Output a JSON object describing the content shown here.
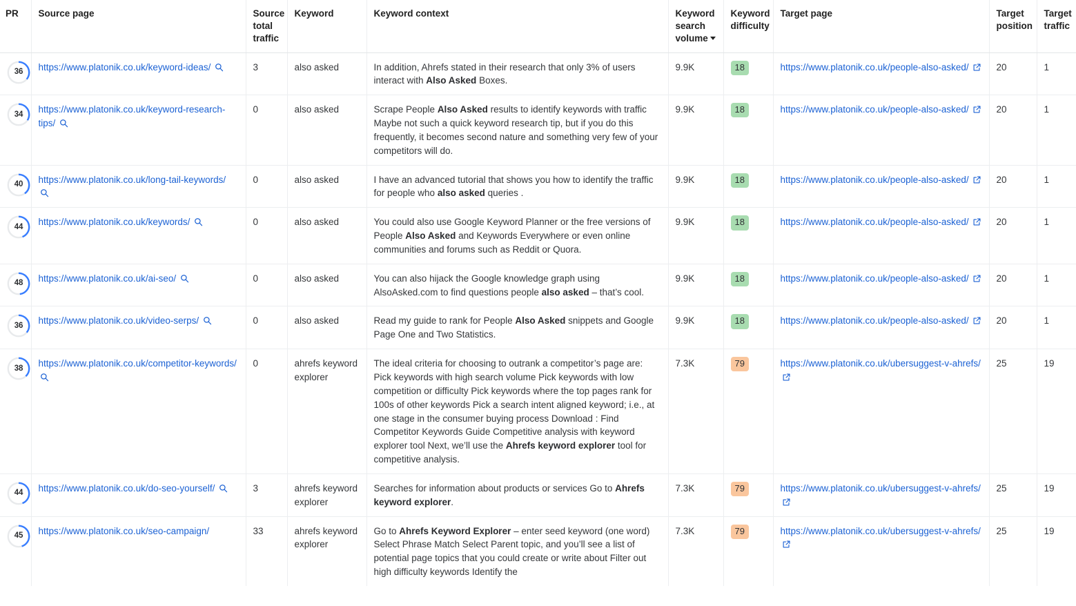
{
  "table": {
    "columns": [
      {
        "key": "pr",
        "label": "PR"
      },
      {
        "key": "source",
        "label": "Source page"
      },
      {
        "key": "stt",
        "label": "Source total traffic"
      },
      {
        "key": "keyword",
        "label": "Keyword"
      },
      {
        "key": "context",
        "label": "Keyword context"
      },
      {
        "key": "ksv",
        "label": "Keyword search volume",
        "sorted": "desc",
        "sort_icon": "caret-down-icon"
      },
      {
        "key": "kd",
        "label": "Keyword difficulty"
      },
      {
        "key": "target",
        "label": "Target page"
      },
      {
        "key": "tpos",
        "label": "Target position"
      },
      {
        "key": "ttraf",
        "label": "Target traffic"
      }
    ],
    "colors": {
      "link": "#1c62d4",
      "donut_arc": "#377dff",
      "donut_track": "#e8eaec",
      "kd_low_bg": "#a8dcb0",
      "kd_high_bg": "#fac69d",
      "border": "#eceef0"
    },
    "rows": [
      {
        "pr": "36",
        "source_url": "https://www.platonik.co.uk/keyword-ideas/",
        "source_has_search_icon": true,
        "stt": "3",
        "keyword": "also asked",
        "context_parts": [
          {
            "text": "In addition, Ahrefs stated in their research that only 3% of users interact with ",
            "bold": false
          },
          {
            "text": "Also Asked",
            "bold": true
          },
          {
            "text": " Boxes.",
            "bold": false
          }
        ],
        "ksv": "9.9K",
        "kd": "18",
        "kd_level": "low",
        "target_url": "https://www.platonik.co.uk/people-also-asked/",
        "tpos": "20",
        "ttraf": "1"
      },
      {
        "pr": "34",
        "source_url": "https://www.platonik.co.uk/keyword-research-tips/",
        "source_has_search_icon": true,
        "stt": "0",
        "keyword": "also asked",
        "context_parts": [
          {
            "text": "Scrape People ",
            "bold": false
          },
          {
            "text": "Also Asked",
            "bold": true
          },
          {
            "text": " results to identify keywords with traffic Maybe not such a quick keyword research tip, but if you do this frequently, it becomes second nature and something very few of your competitors will do.",
            "bold": false
          }
        ],
        "ksv": "9.9K",
        "kd": "18",
        "kd_level": "low",
        "target_url": "https://www.platonik.co.uk/people-also-asked/",
        "tpos": "20",
        "ttraf": "1"
      },
      {
        "pr": "40",
        "source_url": "https://www.platonik.co.uk/long-tail-keywords/",
        "source_has_search_icon": true,
        "stt": "0",
        "keyword": "also asked",
        "context_parts": [
          {
            "text": "I have an advanced tutorial that shows you  how to identify the traffic for people who ",
            "bold": false
          },
          {
            "text": "also asked",
            "bold": true
          },
          {
            "text": " queries .",
            "bold": false
          }
        ],
        "ksv": "9.9K",
        "kd": "18",
        "kd_level": "low",
        "target_url": "https://www.platonik.co.uk/people-also-asked/",
        "tpos": "20",
        "ttraf": "1"
      },
      {
        "pr": "44",
        "source_url": "https://www.platonik.co.uk/keywords/",
        "source_has_search_icon": true,
        "stt": "0",
        "keyword": "also asked",
        "context_parts": [
          {
            "text": "You could also use Google Keyword Planner or the free versions of People ",
            "bold": false
          },
          {
            "text": "Also Asked",
            "bold": true
          },
          {
            "text": " and Keywords Everywhere or even online communities and forums such as Reddit or Quora.",
            "bold": false
          }
        ],
        "ksv": "9.9K",
        "kd": "18",
        "kd_level": "low",
        "target_url": "https://www.platonik.co.uk/people-also-asked/",
        "tpos": "20",
        "ttraf": "1"
      },
      {
        "pr": "48",
        "source_url": "https://www.platonik.co.uk/ai-seo/",
        "source_has_search_icon": true,
        "stt": "0",
        "keyword": "also asked",
        "context_parts": [
          {
            "text": "You can also hijack the Google knowledge graph using AlsoAsked.com  to find questions people ",
            "bold": false
          },
          {
            "text": "also asked",
            "bold": true
          },
          {
            "text": " – that’s cool.",
            "bold": false
          }
        ],
        "ksv": "9.9K",
        "kd": "18",
        "kd_level": "low",
        "target_url": "https://www.platonik.co.uk/people-also-asked/",
        "tpos": "20",
        "ttraf": "1"
      },
      {
        "pr": "36",
        "source_url": "https://www.platonik.co.uk/video-serps/",
        "source_has_search_icon": true,
        "stt": "0",
        "keyword": "also asked",
        "context_parts": [
          {
            "text": "Read my guide to rank for People ",
            "bold": false
          },
          {
            "text": "Also Asked",
            "bold": true
          },
          {
            "text": " snippets and Google Page One and Two Statistics.",
            "bold": false
          }
        ],
        "ksv": "9.9K",
        "kd": "18",
        "kd_level": "low",
        "target_url": "https://www.platonik.co.uk/people-also-asked/",
        "tpos": "20",
        "ttraf": "1"
      },
      {
        "pr": "38",
        "source_url": "https://www.platonik.co.uk/competitor-keywords/",
        "source_has_search_icon": true,
        "stt": "0",
        "keyword": "ahrefs keyword explorer",
        "context_parts": [
          {
            "text": "The ideal criteria for choosing to outrank a competitor’s page are: Pick keywords with high search volume Pick keywords with low competition or difficulty Pick keywords where the top pages rank for 100s of other keywords Pick a search intent aligned keyword; i.e., at one stage in the consumer buying process Download : Find Competitor Keywords Guide Competitive analysis with keyword explorer tool Next, we’ll use the ",
            "bold": false
          },
          {
            "text": "Ahrefs keyword explorer",
            "bold": true
          },
          {
            "text": " tool for competitive analysis.",
            "bold": false
          }
        ],
        "ksv": "7.3K",
        "kd": "79",
        "kd_level": "high",
        "target_url": "https://www.platonik.co.uk/ubersuggest-v-ahrefs/",
        "tpos": "25",
        "ttraf": "19"
      },
      {
        "pr": "44",
        "source_url": "https://www.platonik.co.uk/do-seo-yourself/",
        "source_has_search_icon": true,
        "stt": "3",
        "keyword": "ahrefs keyword explorer",
        "context_parts": [
          {
            "text": "Searches for information about products or services Go to ",
            "bold": false
          },
          {
            "text": "Ahrefs keyword explorer",
            "bold": true
          },
          {
            "text": ".",
            "bold": false
          }
        ],
        "ksv": "7.3K",
        "kd": "79",
        "kd_level": "high",
        "target_url": "https://www.platonik.co.uk/ubersuggest-v-ahrefs/",
        "tpos": "25",
        "ttraf": "19"
      },
      {
        "pr": "45",
        "source_url": "https://www.platonik.co.uk/seo-campaign/",
        "source_has_search_icon": false,
        "stt": "33",
        "keyword": "ahrefs keyword explorer",
        "context_parts": [
          {
            "text": "Go to ",
            "bold": false
          },
          {
            "text": "Ahrefs Keyword Explorer",
            "bold": true
          },
          {
            "text": " – enter seed keyword (one word) Select Phrase Match Select Parent topic, and you’ll see a list of potential page topics that you could create or write about Filter out high difficulty keywords Identify the",
            "bold": false
          }
        ],
        "ksv": "7.3K",
        "kd": "79",
        "kd_level": "high",
        "target_url": "https://www.platonik.co.uk/ubersuggest-v-ahrefs/",
        "tpos": "25",
        "ttraf": "19"
      }
    ]
  }
}
